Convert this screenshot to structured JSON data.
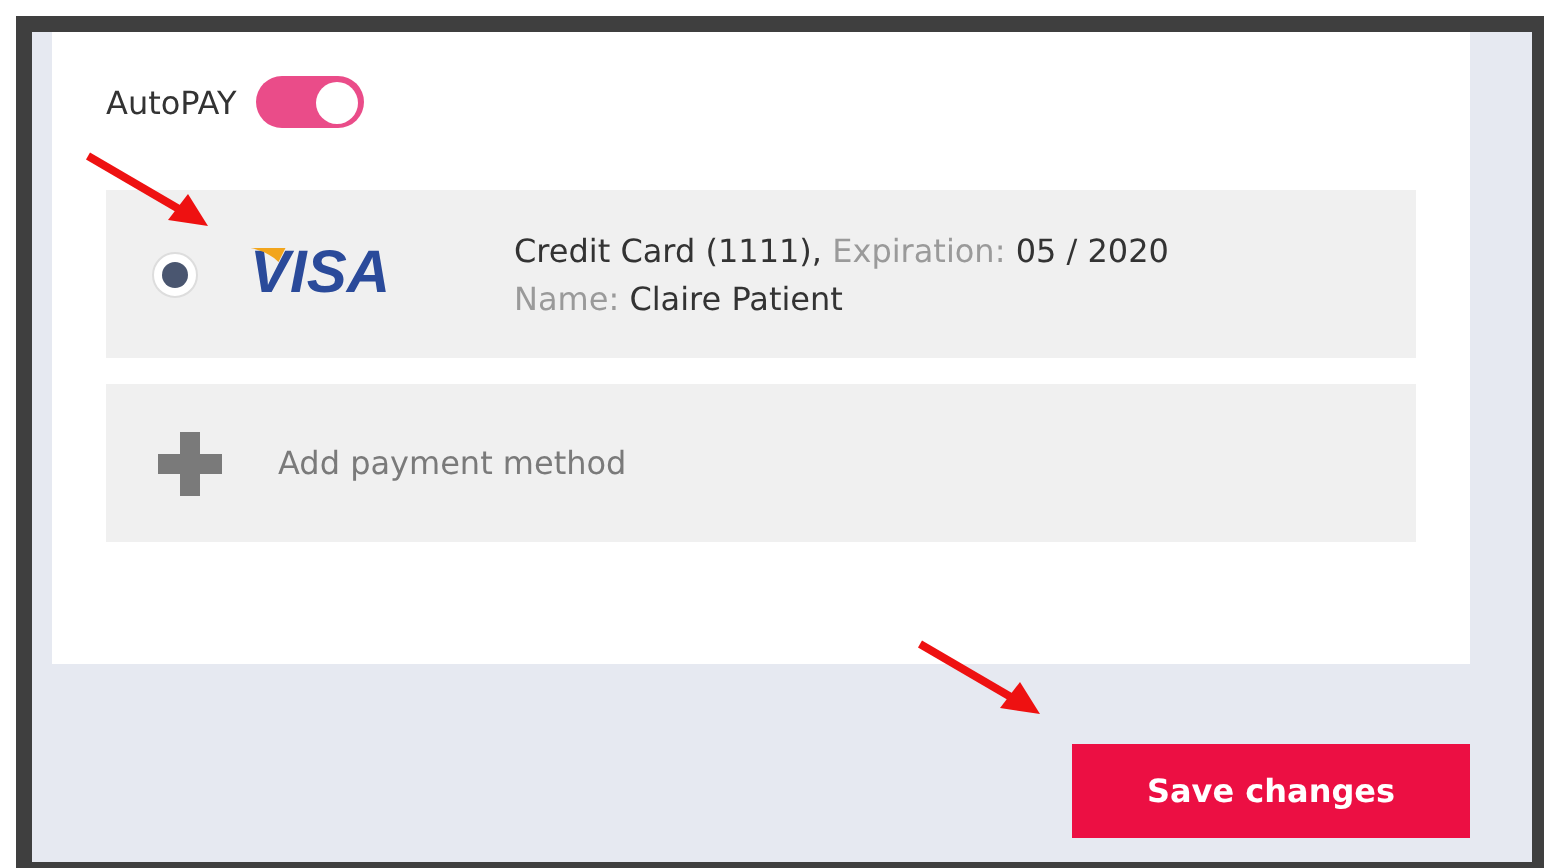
{
  "autopay": {
    "label": "AutoPAY",
    "on": true
  },
  "payment_methods": [
    {
      "brand": "VISA",
      "selected": true,
      "description": "Credit Card (1111),",
      "expiration_label": "Expiration:",
      "expiration": "05 / 2020",
      "name_label": "Name:",
      "name": "Claire Patient"
    }
  ],
  "add_payment": {
    "label": "Add payment method"
  },
  "buttons": [
    {
      "label": "Save changes"
    }
  ]
}
